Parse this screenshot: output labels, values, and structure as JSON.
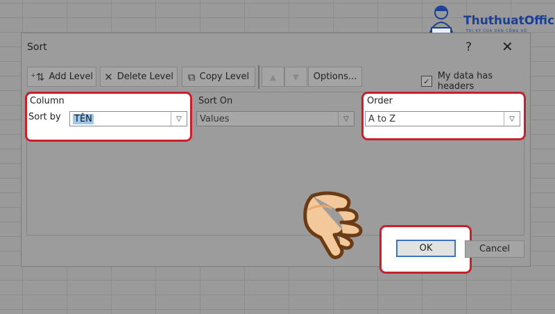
{
  "logo": {
    "brand": "ThuthuatOffice",
    "tagline": "TRI KỲ CỦA DÂN CÔNG SỞ"
  },
  "dialog": {
    "title": "Sort",
    "help": "?",
    "close": "✕",
    "toolbar": {
      "add_level": "Add Level",
      "delete_level": "Delete Level",
      "copy_level": "Copy Level",
      "options": "Options...",
      "move_up": "▲",
      "move_down": "▼"
    },
    "my_data_has_headers": {
      "label": "My data has headers",
      "checked": true
    },
    "columns": {
      "column": "Column",
      "sort_on": "Sort On",
      "order": "Order"
    },
    "row": {
      "label": "Sort by",
      "column_value": "TÊN",
      "sort_on_value": "Values",
      "order_value": "A to Z"
    },
    "buttons": {
      "ok": "OK",
      "cancel": "Cancel"
    }
  },
  "colors": {
    "highlight": "#c8202a",
    "selection": "#9ec9ef",
    "brand": "#1b3f96"
  }
}
